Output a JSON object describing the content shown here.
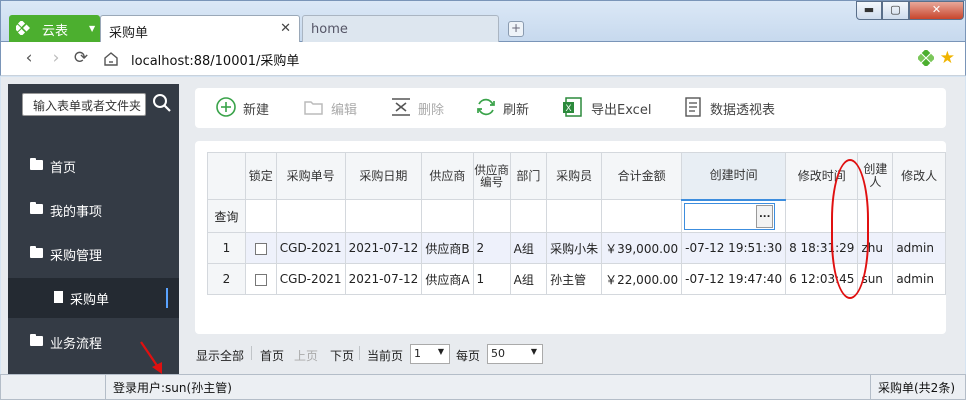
{
  "browser": {
    "brand_label": "云表",
    "tabs": [
      {
        "label": "采购单",
        "active": true
      },
      {
        "label": "home",
        "active": false
      }
    ],
    "url": "localhost:88/10001/采购单"
  },
  "sidebar": {
    "search_placeholder": "输入表单或者文件夹",
    "items": [
      {
        "label": "首页"
      },
      {
        "label": "我的事项"
      },
      {
        "label": "采购管理"
      },
      {
        "label": "采购单"
      },
      {
        "label": "业务流程"
      }
    ]
  },
  "toolbar": {
    "new_label": "新建",
    "edit_label": "编辑",
    "delete_label": "删除",
    "refresh_label": "刷新",
    "export_label": "导出Excel",
    "pivot_label": "数据透视表"
  },
  "grid": {
    "columns": [
      "锁定",
      "采购单号",
      "采购日期",
      "供应商",
      "供应商编号",
      "部门",
      "采购员",
      "合计金额",
      "创建时间",
      "修改时间",
      "创建人",
      "修改人"
    ],
    "query_label": "查询",
    "date_button_label": "...",
    "rows": [
      {
        "num": "1",
        "order_no": "CGD-2021",
        "date": "2021-07-12",
        "supplier": "供应商B",
        "supplier_no": "2",
        "dept": "A组",
        "buyer": "采购小朱",
        "total": "￥39,000.00",
        "created": "-07-12 19:51:30",
        "modified": "8 18:31:29",
        "creator": "zhu",
        "modifier": "admin"
      },
      {
        "num": "2",
        "order_no": "CGD-2021",
        "date": "2021-07-12",
        "supplier": "供应商A",
        "supplier_no": "1",
        "dept": "A组",
        "buyer": "孙主管",
        "total": "￥22,000.00",
        "created": "-07-12 19:47:40",
        "modified": "6 12:03:45",
        "creator": "sun",
        "modifier": "admin"
      }
    ]
  },
  "pager": {
    "show_all": "显示全部",
    "first": "首页",
    "prev": "上页",
    "next": "下页",
    "current_label": "当前页",
    "current_value": "1",
    "per_page_label": "每页",
    "per_page_value": "50"
  },
  "status": {
    "user": "登录用户:sun(孙主管)",
    "summary": "采购单(共2条)"
  },
  "colors": {
    "brand_green": "#4caf2f",
    "sidebar_bg": "#343b45",
    "annotation_red": "#e01010"
  }
}
